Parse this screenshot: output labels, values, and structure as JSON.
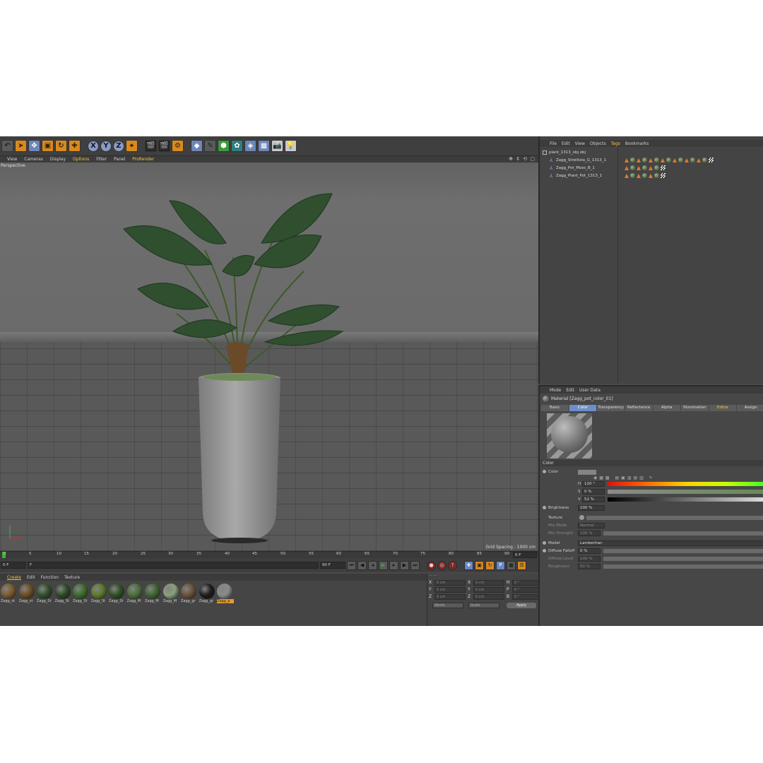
{
  "toolbar": {
    "axis_buttons": [
      "X",
      "Y",
      "Z"
    ]
  },
  "viewport": {
    "menu": [
      "View",
      "Cameras",
      "Display",
      "Options",
      "Filter",
      "Panel",
      "ProRender"
    ],
    "label": "Perspective",
    "grid_spacing": "Grid Spacing : 1000 cm"
  },
  "timeline": {
    "ticks": [
      "0",
      "5",
      "10",
      "15",
      "20",
      "25",
      "30",
      "35",
      "40",
      "45",
      "50",
      "55",
      "60",
      "65",
      "70",
      "75",
      "80",
      "85",
      "90"
    ],
    "end_frame_readout": "0 F",
    "start_field": "0 F",
    "range_field": "F",
    "end_field": "90 F",
    "range_end": "90 F"
  },
  "materials": {
    "menu": [
      "Create",
      "Edit",
      "Function",
      "Texture"
    ],
    "items": [
      {
        "name": "Zagg_st",
        "color": "#7a5a2e"
      },
      {
        "name": "Zagg_st",
        "color": "#6b4b22"
      },
      {
        "name": "Zagg_St",
        "color": "#2f4f2a"
      },
      {
        "name": "Zagg_St",
        "color": "#2c4a26"
      },
      {
        "name": "Zagg_St",
        "color": "#3a6a2a"
      },
      {
        "name": "Zagg_St",
        "color": "#5d7a2a"
      },
      {
        "name": "Zagg_St",
        "color": "#2e4f22"
      },
      {
        "name": "Zagg_M",
        "color": "#4b6e3a"
      },
      {
        "name": "Zagg_M",
        "color": "#3e6432"
      },
      {
        "name": "Zagg_M",
        "color": "#8aa07a"
      },
      {
        "name": "Zagg_gr",
        "color": "#6a5038"
      },
      {
        "name": "Zagg_gr",
        "color": "#1c1c1c"
      },
      {
        "name": "Zagg_p",
        "color": "#8a8a8a"
      }
    ]
  },
  "coords": {
    "rows": [
      {
        "a": "X",
        "av": "0 cm",
        "b": "X",
        "bv": "0 cm",
        "c": "H",
        "cv": "0 °"
      },
      {
        "a": "Y",
        "av": "0 cm",
        "b": "Y",
        "bv": "0 cm",
        "c": "P",
        "cv": "0 °"
      },
      {
        "a": "Z",
        "av": "0 cm",
        "b": "Z",
        "bv": "0 cm",
        "c": "B",
        "cv": "0 °"
      }
    ],
    "world": "World",
    "scale": "Scale",
    "apply": "Apply"
  },
  "objects": {
    "menu": [
      "File",
      "Edit",
      "View",
      "Objects",
      "Tags",
      "Bookmarks"
    ],
    "rows": [
      "plant_1313_obj.obj",
      "Zagg_Strelitzia_G_1313_1",
      "Zagg_Pot_Moss_B_1",
      "Zagg_Plant_Pot_1313_1"
    ]
  },
  "attributes": {
    "menu": [
      "Mode",
      "Edit",
      "User Data"
    ],
    "material_title": "Material [Zagg_pot_color_01]",
    "tabs": [
      "Basic",
      "Color",
      "Transparency",
      "Reflectance",
      "Alpha",
      "Illumination",
      "Editor",
      "Assign"
    ],
    "section": "Color",
    "color_label": "Color",
    "h_label": "H",
    "h_value": "120 °",
    "s_label": "S",
    "s_value": "0 %",
    "v_label": "V",
    "v_value": "52 %",
    "brightness_label": "Brightness",
    "brightness_value": "100 %",
    "texture_label": "Texture",
    "mix_mode_label": "Mix Mode",
    "mix_mode_value": "Normal",
    "mix_strength_label": "Mix Strength",
    "mix_strength_value": "100 %",
    "model_label": "Model",
    "model_value": "Lambertian",
    "diffuse_falloff_label": "Diffuse Falloff",
    "diffuse_falloff_value": "0 %",
    "diffuse_level_label": "Diffuse Level",
    "diffuse_level_value": "100 %",
    "roughness_label": "Roughness",
    "roughness_value": "50 %"
  }
}
